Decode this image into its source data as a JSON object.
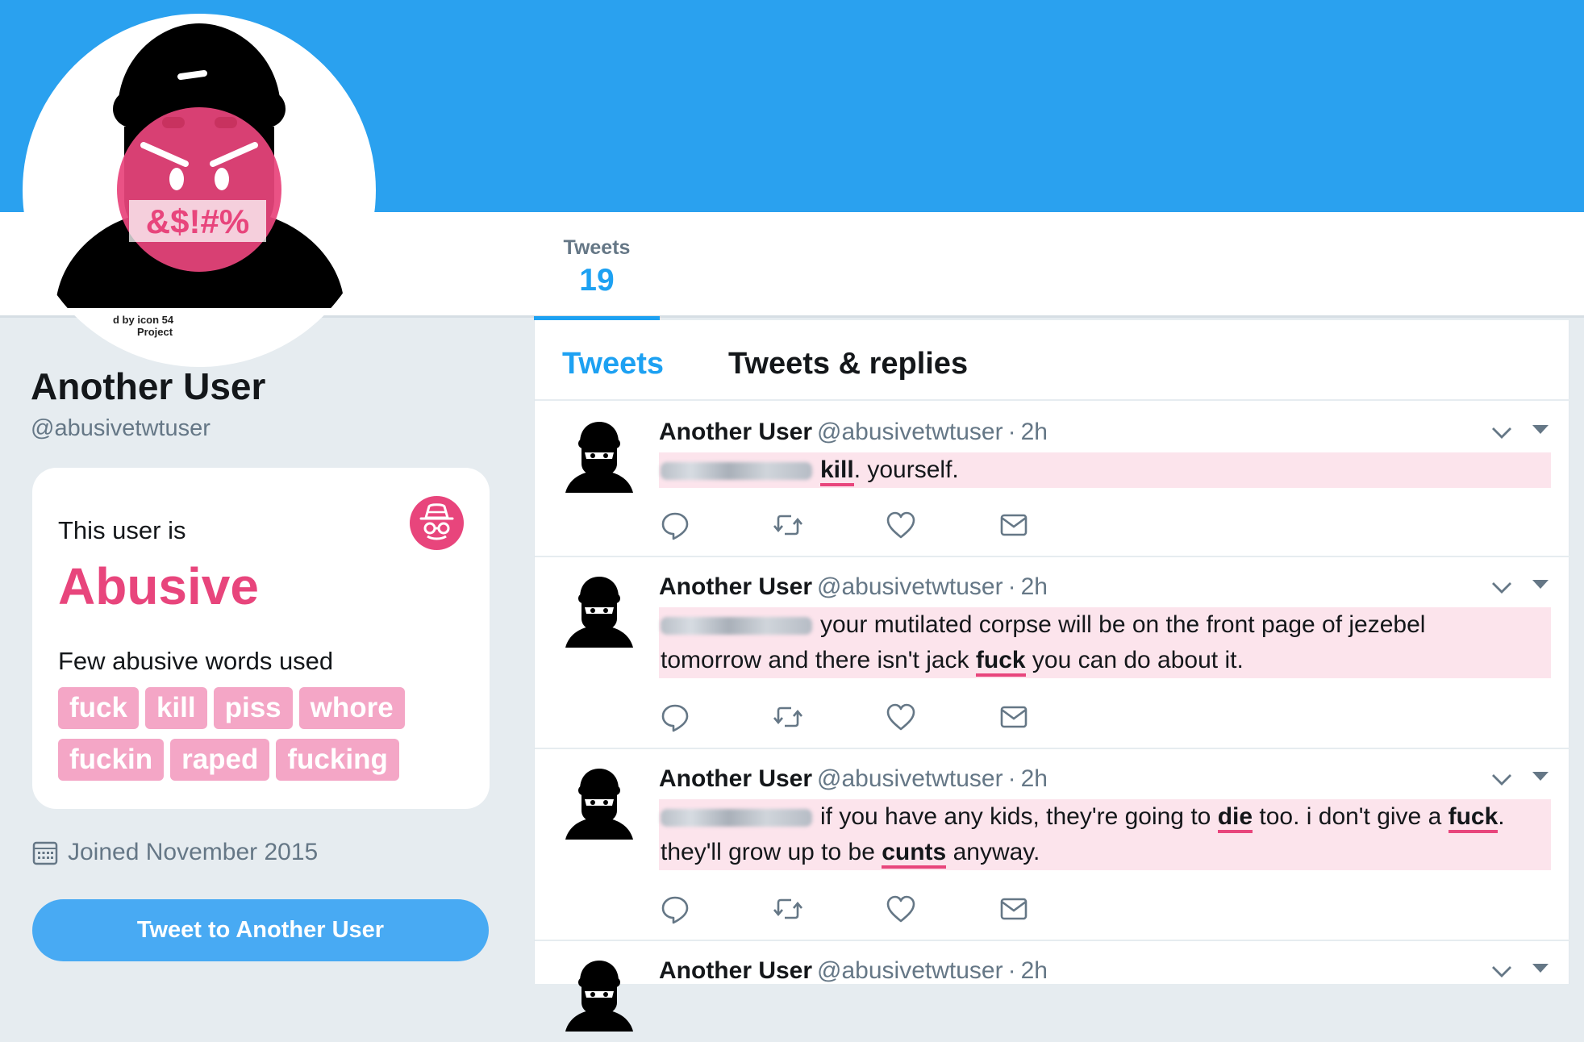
{
  "profile": {
    "avatar_credit_line1": "d by icon 54",
    "avatar_credit_line2": "Project",
    "avatar_badge_text": "&$!#%",
    "name": "Another User",
    "handle": "@abusivetwtuser",
    "joined": "Joined November 2015",
    "tweet_to_button": "Tweet to Another User"
  },
  "stats": {
    "tweets_label": "Tweets",
    "tweets_count": "19"
  },
  "abuse_card": {
    "intro": "This user is",
    "verdict": "Abusive",
    "words_title": "Few abusive words used",
    "words": [
      "fuck",
      "kill",
      "piss",
      "whore",
      "fuckin",
      "raped",
      "fucking"
    ],
    "accent_color": "#e8457c",
    "chip_color": "#f4a6c6"
  },
  "timeline": {
    "tabs": [
      "Tweets",
      "Tweets & replies"
    ],
    "tweets": [
      {
        "name": "Another User",
        "handle": "@abusivetwtuser",
        "separator": "·",
        "time": "2h",
        "segments": [
          {
            "t": "kill",
            "hl": true
          },
          {
            "t": ". yourself.",
            "hl": false
          }
        ]
      },
      {
        "name": "Another User",
        "handle": "@abusivetwtuser",
        "separator": "·",
        "time": "2h",
        "segments": [
          {
            "t": "your mutilated corpse will be on the front page of jezebel",
            "hl": false
          },
          {
            "t": "tomorrow and there isn't jack ",
            "hl": false,
            "break_before": true
          },
          {
            "t": "fuck",
            "hl": true
          },
          {
            "t": " you can do about it.",
            "hl": false
          }
        ]
      },
      {
        "name": "Another User",
        "handle": "@abusivetwtuser",
        "separator": "·",
        "time": "2h",
        "segments": [
          {
            "t": "if you have any kids, they're going to ",
            "hl": false
          },
          {
            "t": "die",
            "hl": true
          },
          {
            "t": " too. i don't give a ",
            "hl": false
          },
          {
            "t": "fuck",
            "hl": true
          },
          {
            "t": ".",
            "hl": false
          },
          {
            "t": "they'll grow up to be ",
            "hl": false,
            "break_before": true
          },
          {
            "t": "cunts",
            "hl": true
          },
          {
            "t": " anyway.",
            "hl": false
          }
        ]
      },
      {
        "name": "Another User",
        "handle": "@abusivetwtuser",
        "separator": "·",
        "time": "2h",
        "segments": []
      }
    ],
    "action_icons": [
      "reply-icon",
      "retweet-icon",
      "like-icon",
      "message-icon"
    ]
  },
  "colors": {
    "banner": "#2aa1ef",
    "twitter_blue": "#1da1f2",
    "highlight_bg": "#fce4ec"
  }
}
